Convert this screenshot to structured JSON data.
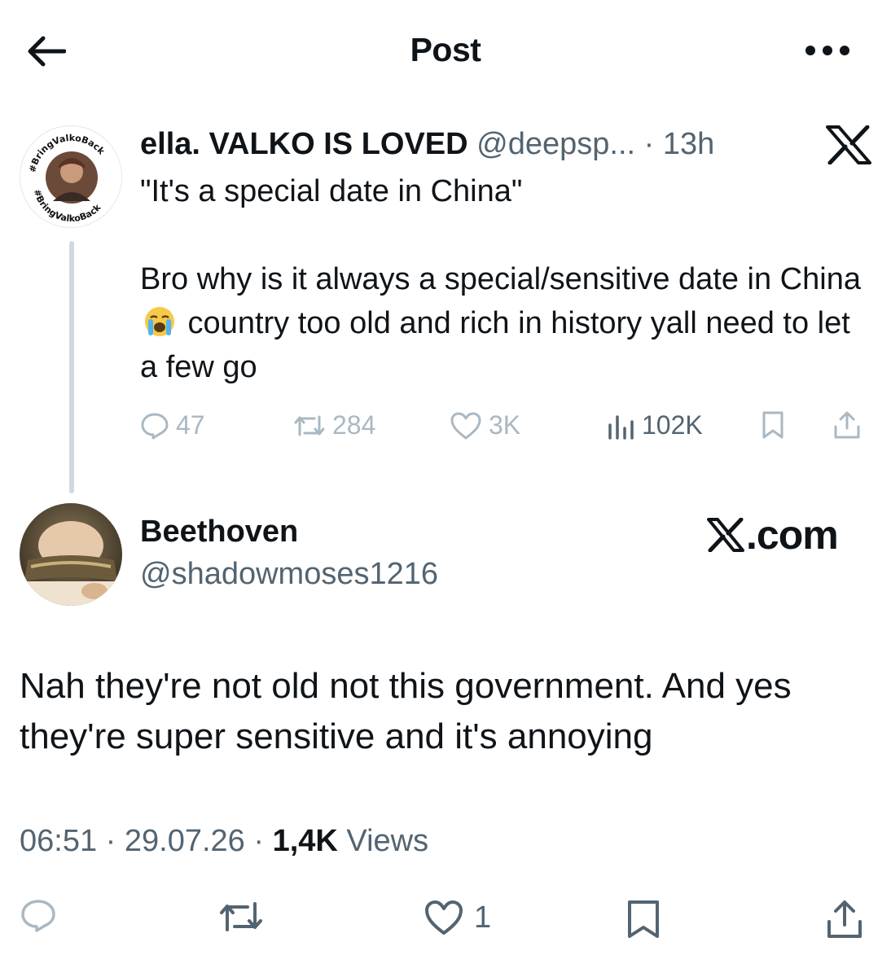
{
  "header": {
    "title": "Post"
  },
  "quoted_post": {
    "author_name": "ella. VALKO IS LOVED",
    "handle": "@deepsp...",
    "separator": "·",
    "time": "13h",
    "avatar_badge_text": "#BringValkoBack",
    "text_lines": [
      "\"It's a special date in China\"",
      "",
      "Bro why is it always a special/sensitive date in China",
      "country too old and rich in history yall need to let a few go"
    ],
    "text_part1": "\"It's a special date in China\"",
    "text_part2": "Bro why is it always a special/sensitive date in China ",
    "emoji": "loudly-crying-face",
    "text_part3": " country too old and rich in history yall need to let a few go",
    "actions": {
      "replies": "47",
      "reposts": "284",
      "likes": "3K",
      "views": "102K"
    }
  },
  "reply": {
    "author_name": "Beethoven",
    "handle": "@shadowmoses1216",
    "watermark": ".com",
    "text": "Nah they're not old not this government. And yes they're super sensitive and it's annoying",
    "time": "06:51",
    "date": "29.07.26",
    "views_count": "1,4K",
    "views_label": "Views",
    "like_count": "1"
  },
  "colors": {
    "text": "#0f1419",
    "secondary": "#536471",
    "faded": "#aab8c2",
    "thread_line": "#cfd9de"
  }
}
